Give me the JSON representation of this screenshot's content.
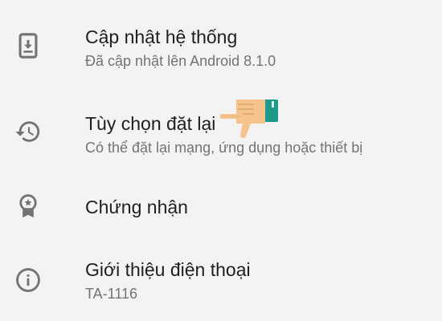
{
  "settings": {
    "items": [
      {
        "icon": "system-update-icon",
        "title": "Cập nhật hệ thống",
        "subtitle": "Đã cập nhật lên Android 8.1.0"
      },
      {
        "icon": "history-icon",
        "title": "Tùy chọn đặt lại",
        "subtitle": "Có thể đặt lại mạng, ứng dụng hoặc thiết bị"
      },
      {
        "icon": "certificate-icon",
        "title": "Chứng nhận"
      },
      {
        "icon": "info-icon",
        "title": "Giới thiệu điện thoại",
        "subtitle": "TA-1116"
      }
    ]
  },
  "colors": {
    "background": "#f3f3f3",
    "icon": "#737373",
    "title": "#1f1f1f",
    "subtitle": "#737373",
    "pointer_hand": "#f4c48c",
    "pointer_cuff": "#1e9a8a"
  },
  "annotation": {
    "icon": "pointing-hand-icon"
  }
}
